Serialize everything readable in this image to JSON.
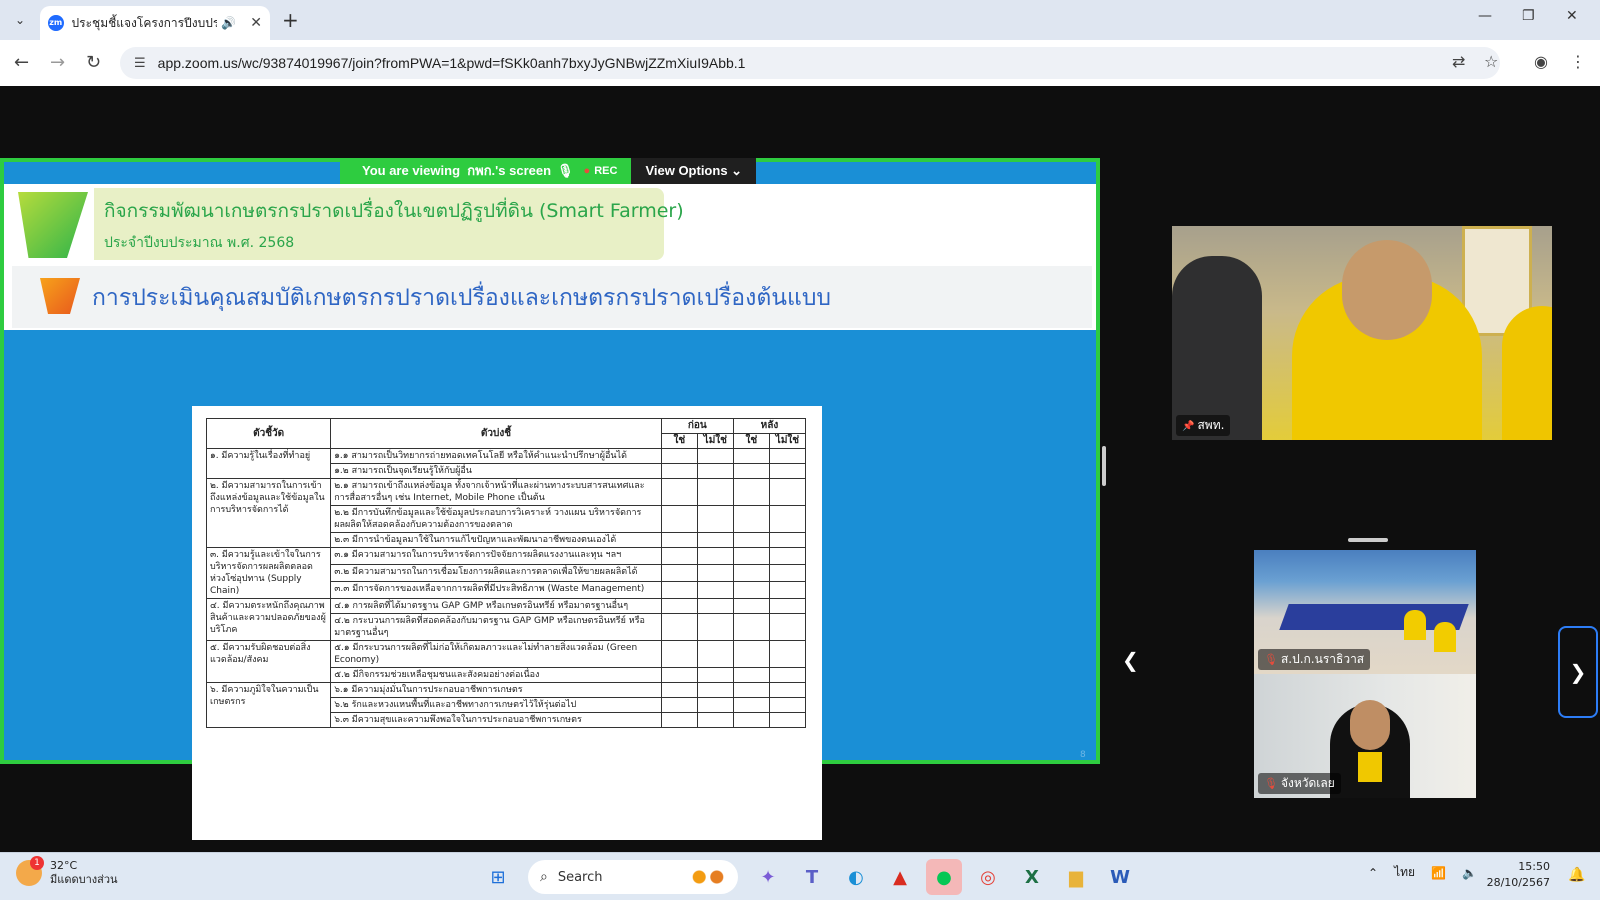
{
  "browser": {
    "tab_title": "ประชุมชี้แจงโครงการปีงบประมาณ",
    "favicon_text": "zm",
    "url": "app.zoom.us/wc/93874019967/join?fromPWA=1&pwd=fSKk0anh7bxyJyGNBwjZZmXiuI9Abb.1",
    "new_tab": "+",
    "minimize": "—",
    "restore": "❐",
    "close": "✕"
  },
  "zoom": {
    "viewing_prefix": "You are viewing",
    "viewing_name": "กพก.'s screen",
    "rec_label": "REC",
    "view_options_label": "View Options",
    "main_video_name": "สพท.",
    "thumbnails": [
      {
        "name": "ส.ป.ก.นราธิวาส"
      },
      {
        "name": "จังหวัดเลย"
      }
    ],
    "colors": {
      "share_border": "#2ecc40",
      "nav_highlight": "#2d7df6"
    }
  },
  "slide": {
    "title": "กิจกรรมพัฒนาเกษตรกรปราดเปรื่องในเขตปฏิรูปที่ดิน (Smart Farmer)",
    "subtitle_year": "ประจำปีงบประมาณ พ.ศ. 2568",
    "heading": "การประเมินคุณสมบัติเกษตรกรปราดเปรื่องและเกษตรกรปราดเปรื่องต้นแบบ",
    "corner_text": "8",
    "table": {
      "col_indicator": "ตัวชี้วัด",
      "col_detail": "ตัวบ่งชี้",
      "col_before": "ก่อน",
      "col_after": "หลัง",
      "yes": "ใช่",
      "no": "ไม่ใช่",
      "groups": [
        {
          "indicator": "๑. มีความรู้ในเรื่องที่ทำอยู่",
          "items": [
            "๑.๑ สามารถเป็นวิทยากรถ่ายทอดเทคโนโลยี หรือให้คำแนะนำปรึกษาผู้อื่นได้",
            "๑.๒ สามารถเป็นจุดเรียนรู้ให้กับผู้อื่น"
          ]
        },
        {
          "indicator": "๒. มีความสามารถในการเข้าถึงแหล่งข้อมูลและใช้ข้อมูลในการบริหารจัดการได้",
          "items": [
            "๒.๑ สามารถเข้าถึงแหล่งข้อมูล ทั้งจากเจ้าหน้าที่และผ่านทางระบบสารสนเทศและการสื่อสารอื่นๆ เช่น Internet, Mobile Phone เป็นต้น",
            "๒.๒ มีการบันทึกข้อมูลและใช้ข้อมูลประกอบการวิเคราะห์ วางแผน บริหารจัดการผลผลิตให้สอดคล้องกับความต้องการของตลาด",
            "๒.๓ มีการนำข้อมูลมาใช้ในการแก้ไขปัญหาและพัฒนาอาชีพของตนเองได้"
          ]
        },
        {
          "indicator": "๓. มีความรู้และเข้าใจในการบริหารจัดการผลผลิตตลอดห่วงโซ่อุปทาน (Supply Chain)",
          "items": [
            "๓.๑ มีความสามารถในการบริหารจัดการปัจจัยการผลิตแรงงานและทุน ฯลฯ",
            "๓.๒ มีความสามารถในการเชื่อมโยงการผลิตและการตลาดเพื่อให้ขายผลผลิตได้",
            "๓.๓ มีการจัดการของเหลือจากการผลิตที่มีประสิทธิภาพ (Waste Management)"
          ]
        },
        {
          "indicator": "๔. มีความตระหนักถึงคุณภาพสินค้าและความปลอดภัยของผู้บริโภค",
          "items": [
            "๔.๑ การผลิตที่ได้มาตรฐาน GAP GMP หรือเกษตรอินทรีย์ หรือมาตรฐานอื่นๆ",
            "๔.๒ กระบวนการผลิตที่สอดคล้องกับมาตรฐาน GAP GMP หรือเกษตรอินทรีย์ หรือมาตรฐานอื่นๆ"
          ]
        },
        {
          "indicator": "๕. มีความรับผิดชอบต่อสิ่งแวดล้อม/สังคม",
          "items": [
            "๕.๑ มีกระบวนการผลิตที่ไม่ก่อให้เกิดมลภาวะและไม่ทำลายสิ่งแวดล้อม (Green Economy)",
            "๕.๒ มีกิจกรรมช่วยเหลือชุมชนและสังคมอย่างต่อเนื่อง"
          ]
        },
        {
          "indicator": "๖. มีความภูมิใจในความเป็นเกษตรกร",
          "items": [
            "๖.๑ มีความมุ่งมั่นในการประกอบอาชีพการเกษตร",
            "๖.๒ รักและหวงแหนพื้นที่และอาชีพทางการเกษตรไว้ให้รุ่นต่อไป",
            "๖.๓ มีความสุขและความพึงพอใจในการประกอบอาชีพการเกษตร"
          ]
        }
      ]
    }
  },
  "taskbar": {
    "temperature": "32°C",
    "weather_desc": "มีแดดบางส่วน",
    "weather_badge": "1",
    "search_label": "Search",
    "language": "ไทย",
    "time": "15:50",
    "date": "28/10/2567"
  }
}
